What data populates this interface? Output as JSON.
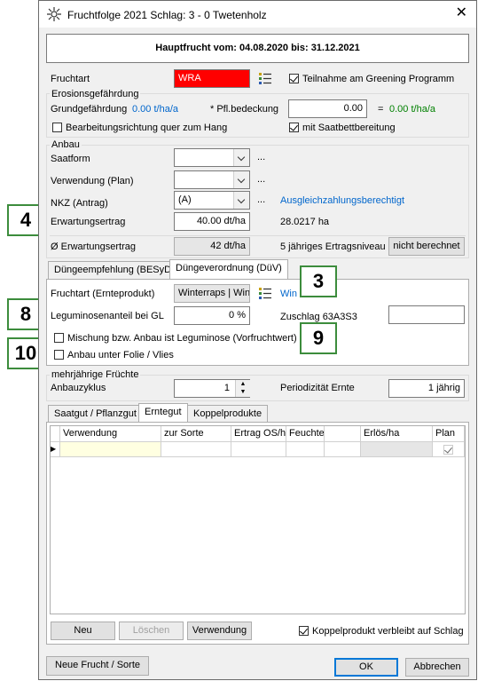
{
  "window": {
    "title": "Fruchtfolge 2021 Schlag: 3 - 0 Twetenholz"
  },
  "header": {
    "text": "Hauptfrucht vom: 04.08.2020 bis: 31.12.2021"
  },
  "fruchtart": {
    "label": "Fruchtart",
    "value": "WRA",
    "value_bg": "#ff0000",
    "greening_label": "Teilnahme am Greening Programm"
  },
  "erosion": {
    "title": "Erosionsgefährdung",
    "grund_label": "Grundgefährdung",
    "grund_value": "0.00 t/ha/a",
    "pfl_label": "* Pfl.bedeckung",
    "pfl_value": "0.00",
    "eq": "=",
    "result": "0.00 t/ha/a",
    "quer_label": "Bearbeitungsrichtung quer zum Hang",
    "saatbett_label": "mit Saatbettbereitung"
  },
  "anbau": {
    "title": "Anbau",
    "saatform_label": "Saatform",
    "verwendung_label": "Verwendung (Plan)",
    "nkz_label": "NKZ  (Antrag)",
    "nkz_value": "(A)",
    "dots": "...",
    "ausgleich": "Ausgleichzahlungsberechtigt",
    "erwartung_label": "Erwartungsertrag",
    "erwartung_value": "40.00 dt/ha",
    "area": "28.0217 ha",
    "avg_label": "Ø Erwartungsertrag",
    "avg_value": "42 dt/ha",
    "five_year": "5 jähriges Ertragsniveau",
    "nicht_btn": "nicht berechnet"
  },
  "tabs1": [
    "Düngeempfehlung (BESyD)",
    "Düngeverordnung (DüV)"
  ],
  "duev": {
    "fruchtart_label": "Fruchtart (Ernteprodukt)",
    "fruchtart_value": "Winterraps | Win",
    "fruchtart_link": "Win",
    "legum_label": "Leguminosenanteil bei GL",
    "legum_value": "0 %",
    "zuschlag_label": "Zuschlag 63A3S3",
    "mischung_label": "Mischung bzw. Anbau ist Leguminose (Vorfruchtwert)",
    "folie_label": "Anbau unter Folie / Vlies"
  },
  "mehrj": {
    "title": "mehrjährige Früchte",
    "zyklus_label": "Anbauzyklus",
    "zyklus_value": "1",
    "period_label": "Periodizität Ernte",
    "period_value": "1 jährig"
  },
  "tabs2": [
    "Saatgut / Pflanzgut",
    "Erntegut",
    "Koppelprodukte"
  ],
  "grid": {
    "columns": [
      "Verwendung",
      "zur Sorte",
      "Ertrag OS/h",
      "Feuchte",
      "",
      "Erlös/ha",
      "Plan"
    ]
  },
  "buttons": {
    "neu": "Neu",
    "loeschen": "Löschen",
    "verwendung": "Verwendung",
    "koppel": "Koppelprodukt verbleibt auf Schlag",
    "neue_frucht": "Neue Frucht / Sorte",
    "ok": "OK",
    "abbrechen": "Abbrechen"
  },
  "callouts": [
    "4",
    "8",
    "10",
    "3",
    "9"
  ]
}
